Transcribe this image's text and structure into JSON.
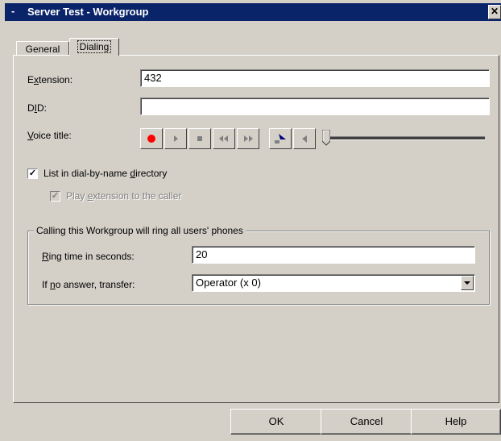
{
  "window": {
    "title": "Server Test - Workgroup",
    "title_dash": "-",
    "close_glyph": "✕"
  },
  "tabs": [
    {
      "label": "General"
    },
    {
      "label": "Dialing"
    }
  ],
  "form": {
    "extension": {
      "label_pre": "E",
      "label_u": "x",
      "label_post": "tension:",
      "value": "432"
    },
    "did": {
      "label_pre": "D",
      "label_u": "I",
      "label_post": "D:",
      "value": ""
    },
    "voice_title": {
      "label_pre": "",
      "label_u": "V",
      "label_post": "oice title:"
    },
    "list_directory": {
      "label_pre": "List in dial-by-name ",
      "label_u": "d",
      "label_post": "irectory",
      "checked": true
    },
    "play_extension": {
      "label_pre": "Play ",
      "label_u": "e",
      "label_post": "xtension to the caller",
      "checked": true,
      "disabled": true
    }
  },
  "group": {
    "legend": "Calling this Workgroup will ring all users' phones",
    "ring_time": {
      "label_pre": "",
      "label_u": "R",
      "label_post": "ing time in seconds:",
      "value": "20"
    },
    "no_answer": {
      "label_pre": "If ",
      "label_u": "n",
      "label_post": "o answer, transfer:",
      "selected": "Operator (x 0)"
    }
  },
  "media_controls": [
    "record-icon",
    "play-icon",
    "stop-icon",
    "rewind-icon",
    "fast-forward-icon",
    "phone-record-icon",
    "phone-play-icon"
  ],
  "buttons": {
    "ok": "OK",
    "cancel": "Cancel",
    "help": "Help"
  },
  "colors": {
    "titlebar": "#0a246a",
    "face": "#d4d0c8",
    "record": "#ff0000"
  }
}
